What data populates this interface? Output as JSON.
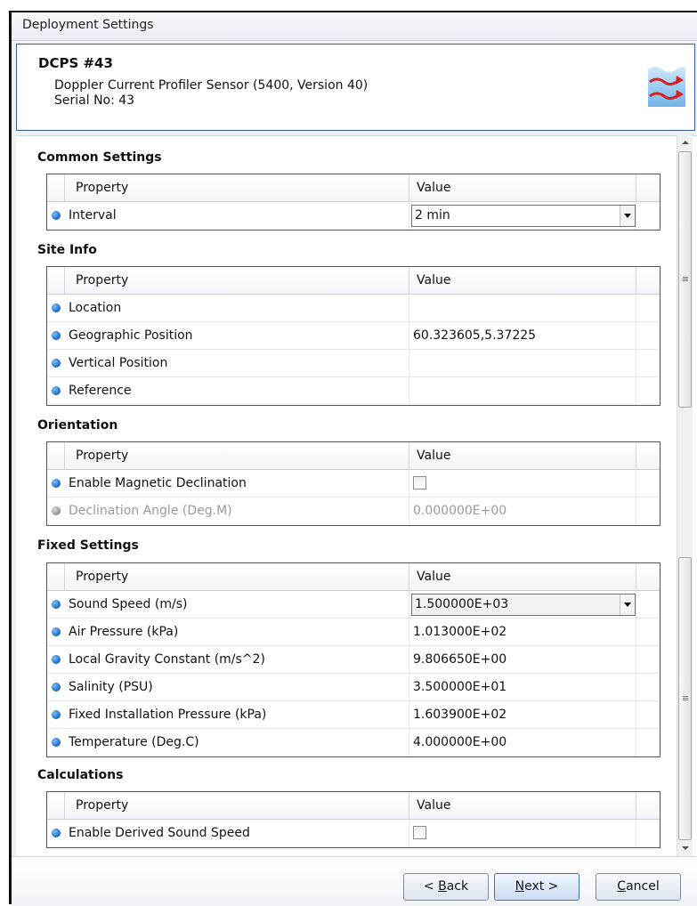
{
  "window": {
    "title": "Deployment Settings"
  },
  "header": {
    "name": "DCPS #43",
    "description": "Doppler Current Profiler Sensor (5400, Version 40)",
    "serial": "Serial No: 43",
    "logo_icon": "wave-arrows-icon"
  },
  "columns": {
    "property": "Property",
    "value": "Value"
  },
  "sections": {
    "common": {
      "title": "Common Settings",
      "rows": [
        {
          "property": "Interval",
          "value": "2 min",
          "type": "combo"
        }
      ]
    },
    "site": {
      "title": "Site Info",
      "rows": [
        {
          "property": "Location",
          "value": ""
        },
        {
          "property": "Geographic Position",
          "value": "60.323605,5.37225"
        },
        {
          "property": "Vertical Position",
          "value": ""
        },
        {
          "property": "Reference",
          "value": ""
        }
      ]
    },
    "orientation": {
      "title": "Orientation",
      "rows": [
        {
          "property": "Enable Magnetic Declination",
          "type": "checkbox",
          "checked": false
        },
        {
          "property": "Declination Angle (Deg.M)",
          "value": "0.000000E+00",
          "disabled": true
        }
      ]
    },
    "fixed": {
      "title": "Fixed Settings",
      "rows": [
        {
          "property": "Sound Speed (m/s)",
          "value": "1.500000E+03",
          "type": "combo"
        },
        {
          "property": "Air Pressure (kPa)",
          "value": "1.013000E+02"
        },
        {
          "property": "Local Gravity Constant (m/s^2)",
          "value": "9.806650E+00"
        },
        {
          "property": "Salinity (PSU)",
          "value": "3.500000E+01"
        },
        {
          "property": "Fixed Installation Pressure (kPa)",
          "value": "1.603900E+02"
        },
        {
          "property": "Temperature (Deg.C)",
          "value": "4.000000E+00"
        }
      ]
    },
    "calculations": {
      "title": "Calculations",
      "rows": [
        {
          "property": "Enable Derived Sound Speed",
          "type": "checkbox",
          "checked": false
        }
      ]
    }
  },
  "buttons": {
    "back": {
      "pre": "< ",
      "key": "B",
      "rest": "ack"
    },
    "next": {
      "key": "N",
      "rest": "ext >"
    },
    "cancel": {
      "key": "C",
      "rest": "ancel"
    }
  },
  "colors": {
    "border_accent": "#3b5fa7",
    "indicator": "#1565c0",
    "disabled_text": "#9a9a9a"
  }
}
